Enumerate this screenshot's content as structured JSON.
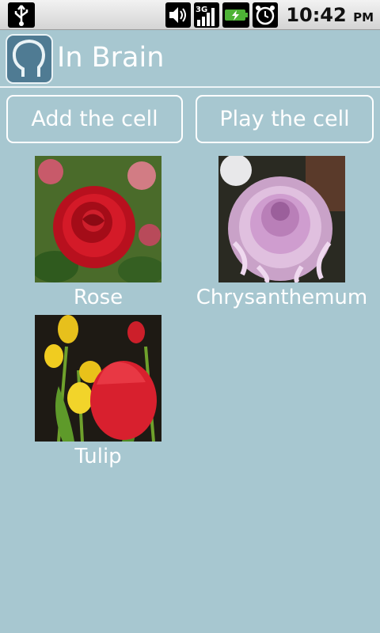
{
  "status_bar": {
    "time": "10:42",
    "ampm": "PM",
    "network": "3G",
    "icons": [
      "usb-icon",
      "volume-icon",
      "signal-3g-icon",
      "battery-charging-icon",
      "alarm-clock-icon"
    ]
  },
  "app": {
    "title": "In Brain",
    "logo_icon": "head-profile-icon",
    "accent": "#4f7b93",
    "background": "#a7c7d0"
  },
  "buttons": {
    "add": "Add the cell",
    "play": "Play the cell"
  },
  "cells": [
    {
      "label": "Rose",
      "image": "rose-image"
    },
    {
      "label": "Chrysanthemum",
      "image": "chrysanthemum-image"
    },
    {
      "label": "Tulip",
      "image": "tulip-image"
    }
  ]
}
